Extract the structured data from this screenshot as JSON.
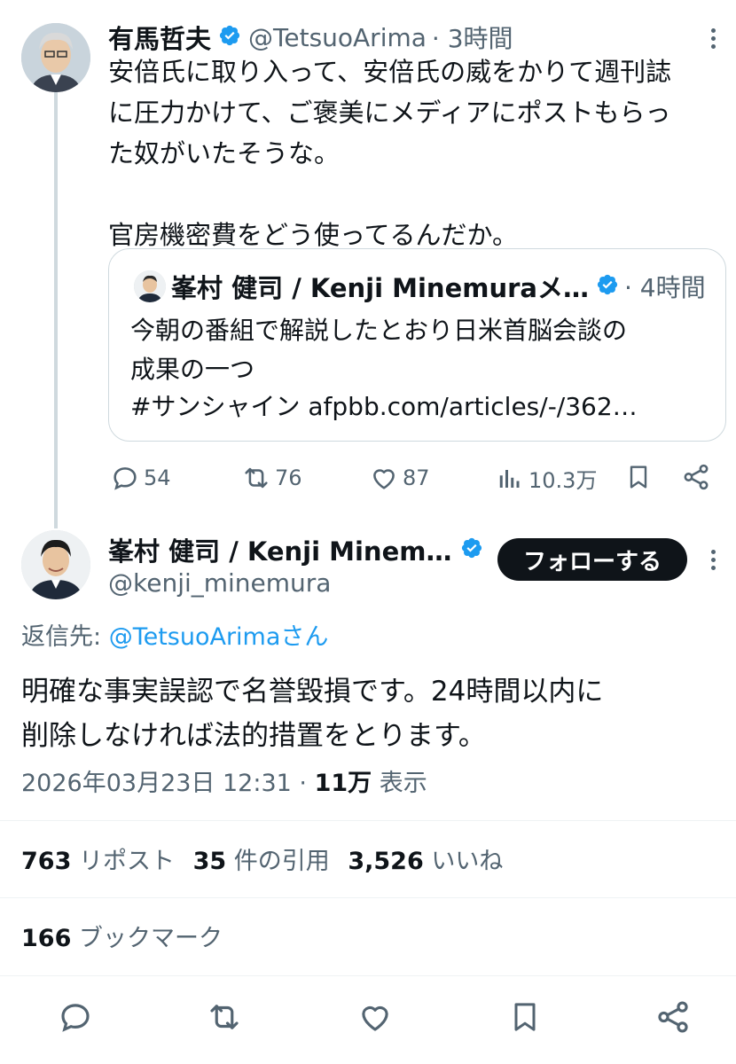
{
  "parent_tweet": {
    "name": "有馬哲夫",
    "handle": "@TetsuoArima",
    "time": "· 3時間",
    "text": "安倍氏に取り入って、安倍氏の威をかりて週刊誌\nに圧力かけて、ご褒美にメディアにポストもらっ\nた奴がいたそうな。\n\n官房機密費をどう使ってるんだか。",
    "quote": {
      "name": "峯村 健司 / Kenji Minemuraメ…",
      "time": "· 4時間",
      "text": "今朝の番組で解説したとおり日米首脳会談の\n成果の一つ",
      "hashtag": "#サンシャイン",
      "link": "afpbb.com/articles/-/362…"
    },
    "actions": {
      "replies": "54",
      "reposts": "76",
      "likes": "87",
      "views": "10.3万"
    }
  },
  "main_tweet": {
    "name": "峯村 健司 / Kenji Minem…",
    "handle": "@kenji_minemura",
    "follow_label": "フォローする",
    "reply_to_prefix": "返信先: ",
    "reply_to_handle": "@TetsuoArimaさん",
    "text": "明確な事実誤認で名誉毀損です。24時間以内に\n削除しなければ法的措置をとります。",
    "timestamp": "2026年03月23日 12:31 · ",
    "views_count": "11万",
    "views_label": " 表示",
    "stats": {
      "reposts_count": "763",
      "reposts_label": " リポスト",
      "quotes_count": "35",
      "quotes_label": " 件の引用",
      "likes_count": "3,526",
      "likes_label": " いいね",
      "bookmarks_count": "166",
      "bookmarks_label": " ブックマーク"
    }
  },
  "colors": {
    "verified": "#1d9bf0",
    "link": "#1d9bf0",
    "secondary": "#536471",
    "text": "#0f1419"
  },
  "icons": [
    "verified-badge-icon",
    "reply-icon",
    "repost-icon",
    "like-icon",
    "views-icon",
    "bookmark-icon",
    "share-icon",
    "more-icon"
  ]
}
